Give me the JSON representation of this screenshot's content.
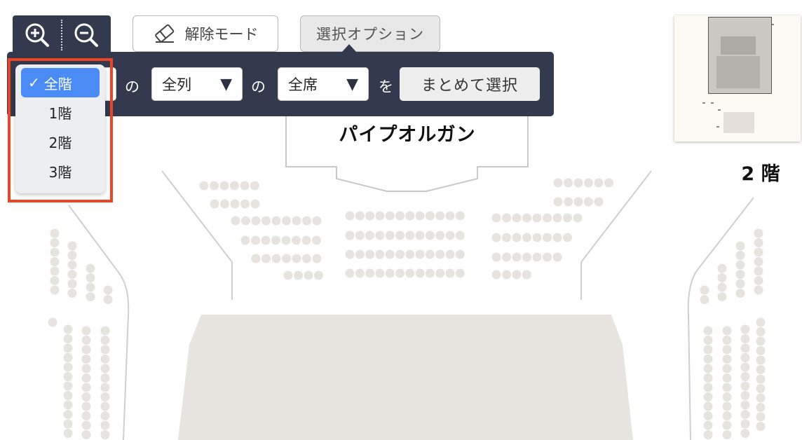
{
  "toolbar": {
    "zoom_in_icon": "zoom-in-icon",
    "zoom_out_icon": "zoom-out-icon",
    "release_mode_label": "解除モード",
    "select_options_label": "選択オプション"
  },
  "options_panel": {
    "connector_no_1": "の",
    "connector_no_2": "の",
    "connector_wo": "を",
    "column_select_value": "全列",
    "seat_select_value": "全席",
    "bulk_select_label": "まとめて選択"
  },
  "floor_dropdown": {
    "options": [
      {
        "label": "全階",
        "selected": true
      },
      {
        "label": "1階",
        "selected": false
      },
      {
        "label": "2階",
        "selected": false
      },
      {
        "label": "3階",
        "selected": false
      }
    ],
    "check_icon": "checkmark-icon",
    "highlight_color": "#ee4424",
    "selected_color": "#4a8bf5"
  },
  "seatmap": {
    "organ_label": "パイプオルガン",
    "floor_label": "2 階"
  },
  "colors": {
    "toolbar_bg": "#333a4d",
    "seat": "#e7e3de",
    "stage": "#e8e4df"
  }
}
